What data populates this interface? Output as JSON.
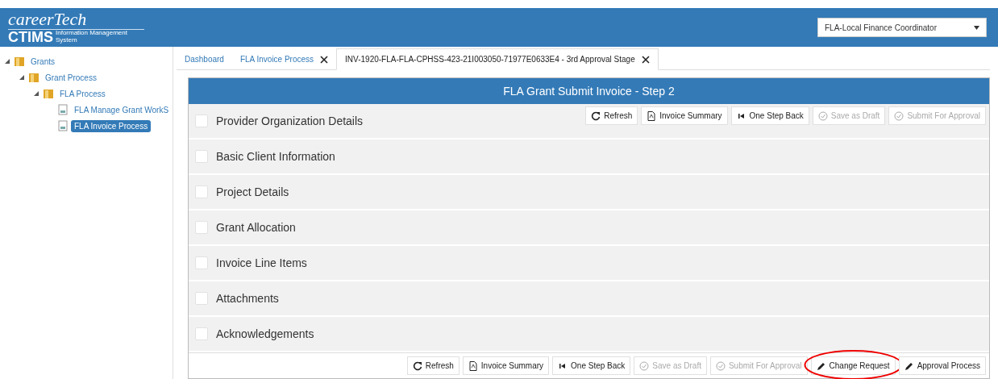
{
  "header": {
    "logo_top": "careerTech",
    "logo_main": "CTIMS",
    "logo_sub": "Information Management System",
    "role_select": {
      "value": "FLA-Local Finance Coordinator"
    }
  },
  "sidebar": {
    "tree": [
      {
        "label": "Grants",
        "kind": "folder",
        "expanded": true,
        "selected": false,
        "children": [
          {
            "label": "Grant Process",
            "kind": "folder",
            "expanded": true,
            "selected": false,
            "children": [
              {
                "label": "FLA Process",
                "kind": "folder",
                "expanded": true,
                "selected": false,
                "children": [
                  {
                    "label": "FLA Manage Grant WorkS",
                    "kind": "page",
                    "selected": false
                  },
                  {
                    "label": "FLA Invoice Process",
                    "kind": "page",
                    "selected": true
                  }
                ]
              }
            ]
          }
        ]
      }
    ]
  },
  "tabs": [
    {
      "label": "Dashboard",
      "selected": false,
      "closable": false
    },
    {
      "label": "FLA Invoice Process",
      "selected": false,
      "closable": true
    },
    {
      "label": "INV-1920-FLA-FLA-CPHSS-423-21I003050-71977E0633E4 - 3rd Approval Stage",
      "selected": true,
      "closable": true
    }
  ],
  "panel": {
    "title": "FLA Grant Submit Invoice - Step 2",
    "top_toolbar": [
      {
        "label": "Refresh",
        "kind": "refresh",
        "disabled": false,
        "highlighted": false
      },
      {
        "label": "Invoice Summary",
        "kind": "document",
        "disabled": false,
        "highlighted": false
      },
      {
        "label": "One Step Back",
        "kind": "back",
        "disabled": false,
        "highlighted": false
      },
      {
        "label": "Save as Draft",
        "kind": "check",
        "disabled": true,
        "highlighted": false
      },
      {
        "label": "Submit For Approval",
        "kind": "check",
        "disabled": true,
        "highlighted": false
      }
    ],
    "sections": [
      "Provider Organization Details",
      "Basic Client Information",
      "Project Details",
      "Grant Allocation",
      "Invoice Line Items",
      "Attachments",
      "Acknowledgements"
    ],
    "bottom_toolbar": [
      {
        "label": "Refresh",
        "kind": "refresh",
        "disabled": false,
        "highlighted": false
      },
      {
        "label": "Invoice Summary",
        "kind": "document",
        "disabled": false,
        "highlighted": false
      },
      {
        "label": "One Step Back",
        "kind": "back",
        "disabled": false,
        "highlighted": false
      },
      {
        "label": "Save as Draft",
        "kind": "check",
        "disabled": true,
        "highlighted": false
      },
      {
        "label": "Submit For Approval",
        "kind": "check",
        "disabled": true,
        "highlighted": false
      },
      {
        "label": "Change Request",
        "kind": "pencil",
        "disabled": false,
        "highlighted": true
      },
      {
        "label": "Approval Process",
        "kind": "pencil",
        "disabled": false,
        "highlighted": false
      }
    ]
  }
}
